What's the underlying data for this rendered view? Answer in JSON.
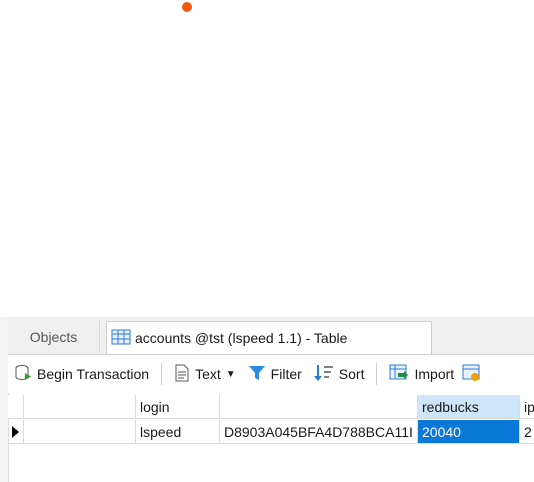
{
  "tabs": {
    "objects_label": "Objects",
    "active_label": "accounts @tst (lspeed 1.1) - Table"
  },
  "toolbar": {
    "begin_transaction": "Begin Transaction",
    "text": "Text",
    "filter": "Filter",
    "sort": "Sort",
    "import": "Import"
  },
  "table": {
    "columns": [
      "",
      "login",
      "",
      "redbucks",
      "ip"
    ],
    "rows": [
      {
        "login": "lspeed",
        "hash": "D8903A045BFA4D788BCA11I",
        "redbucks": "20040",
        "ip": "2"
      }
    ],
    "selected_column": "redbucks"
  },
  "colors": {
    "accent": "#0a78d7",
    "header_highlight": "#cfe5f9",
    "notification_dot": "#f05a0a"
  },
  "icons": [
    "transaction-icon",
    "text-icon",
    "filter-icon",
    "sort-icon",
    "import-icon",
    "table-icon"
  ]
}
